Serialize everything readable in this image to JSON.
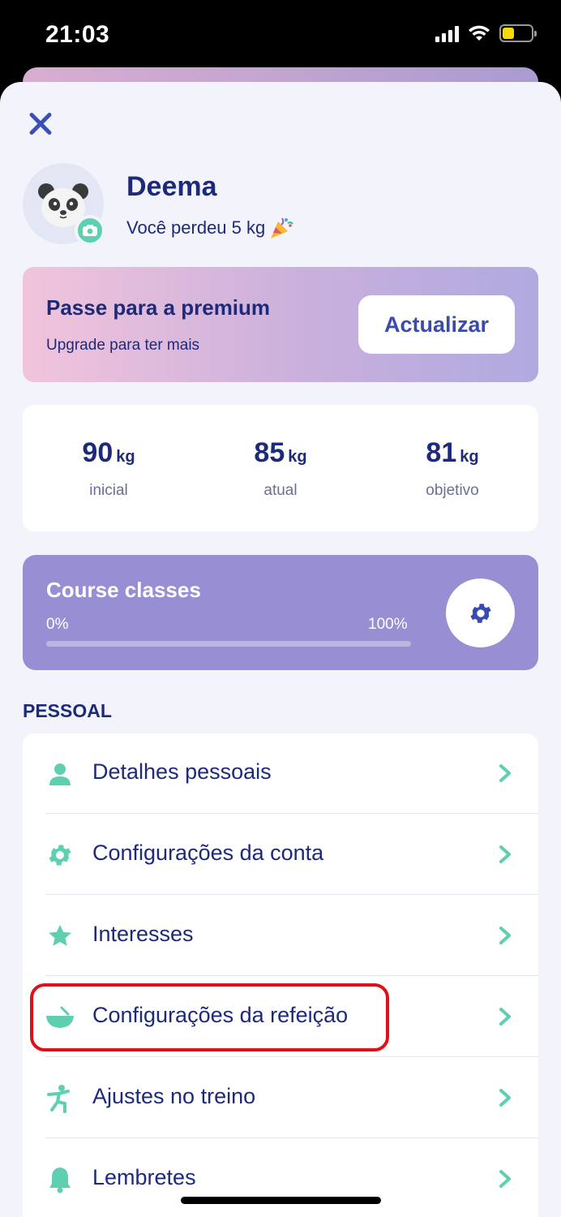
{
  "status_bar": {
    "time": "21:03"
  },
  "profile": {
    "name": "Deema",
    "subtitle": "Você perdeu 5 kg",
    "avatar_icon": "panda-avatar",
    "camera_icon": "camera-icon"
  },
  "premium": {
    "title": "Passe para a premium",
    "subtitle": "Upgrade para ter mais",
    "button_label": "Actualizar"
  },
  "weights": [
    {
      "value": "90",
      "unit": "kg",
      "label": "inicial"
    },
    {
      "value": "85",
      "unit": "kg",
      "label": "atual"
    },
    {
      "value": "81",
      "unit": "kg",
      "label": "objetivo"
    }
  ],
  "course": {
    "title": "Course classes",
    "min_label": "0%",
    "max_label": "100%",
    "progress_fraction": 0.0
  },
  "section": {
    "label": "PESSOAL"
  },
  "menu_items": [
    {
      "label": "Detalhes pessoais",
      "icon": "person-icon"
    },
    {
      "label": "Configurações da conta",
      "icon": "gear-icon"
    },
    {
      "label": "Interesses",
      "icon": "star-icon"
    },
    {
      "label": "Configurações da refeição",
      "icon": "bowl-icon"
    },
    {
      "label": "Ajustes no treino",
      "icon": "exercise-icon"
    },
    {
      "label": "Lembretes",
      "icon": "bell-icon"
    }
  ],
  "colors": {
    "navy": "#1d2a7a",
    "accent_blue": "#3a4bb0",
    "teal": "#5ecfb0",
    "course_purple": "#978ed3",
    "highlight_red": "#e01019"
  }
}
